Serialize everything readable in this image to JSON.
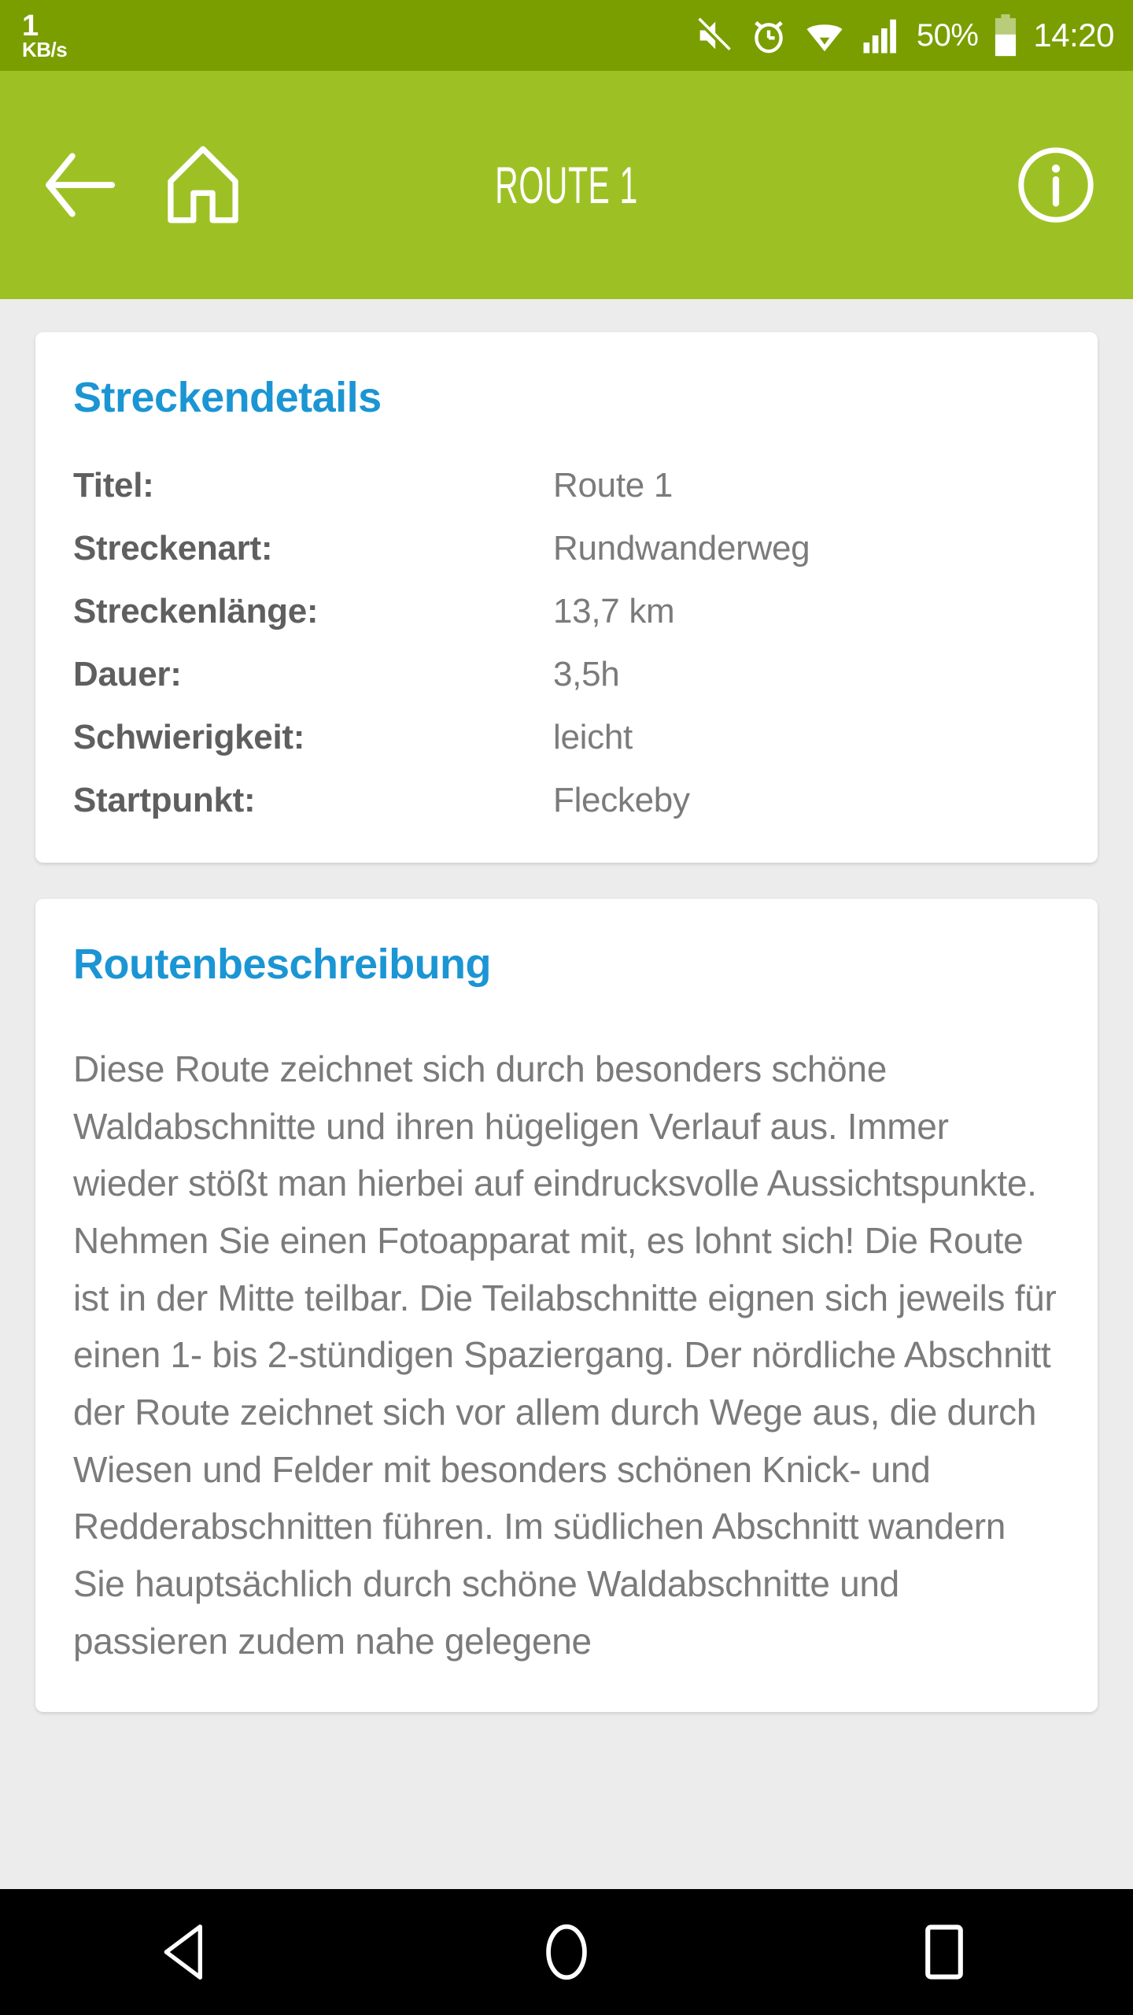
{
  "status_bar": {
    "network_speed_value": "1",
    "network_speed_unit": "KB/s",
    "battery_percent": "50%",
    "time": "14:20",
    "icons": [
      "mute-icon",
      "alarm-icon",
      "wifi-icon",
      "signal-icon",
      "battery-icon"
    ],
    "background_color": "#7a9e00"
  },
  "header": {
    "title": "ROUTE 1",
    "back_icon": "arrow-left-icon",
    "home_icon": "home-icon",
    "info_icon": "info-icon",
    "background_color": "#9dc125"
  },
  "details_card": {
    "title": "Streckendetails",
    "title_color": "#1b95d3",
    "rows": [
      {
        "label": "Titel:",
        "value": "Route 1"
      },
      {
        "label": "Streckenart:",
        "value": "Rundwanderweg"
      },
      {
        "label": "Streckenlänge:",
        "value": "13,7 km"
      },
      {
        "label": "Dauer:",
        "value": "3,5h"
      },
      {
        "label": "Schwierigkeit:",
        "value": "leicht"
      },
      {
        "label": "Startpunkt:",
        "value": "Fleckeby"
      }
    ]
  },
  "description_card": {
    "title": "Routenbeschreibung",
    "body": "Diese Route zeichnet sich durch besonders schöne Waldabschnitte und ihren hügeligen Verlauf aus. Immer wieder stößt man hierbei auf eindrucksvolle Aussichtspunkte. Nehmen Sie einen Fotoapparat mit, es lohnt sich! Die Route ist in der Mitte teilbar. Die Teilabschnitte eignen sich jeweils für einen 1- bis 2-stündigen Spaziergang. Der nördliche Abschnitt der Route zeichnet sich vor allem durch Wege aus, die durch Wiesen und Felder mit besonders schönen Knick- und Redderabschnitten führen.  Im südlichen Abschnitt wandern Sie hauptsächlich durch schöne Waldabschnitte und passieren zudem nahe gelegene"
  },
  "nav_bar": {
    "back": "nav-back-icon",
    "home": "nav-home-icon",
    "recents": "nav-recents-icon",
    "background_color": "#000000"
  }
}
